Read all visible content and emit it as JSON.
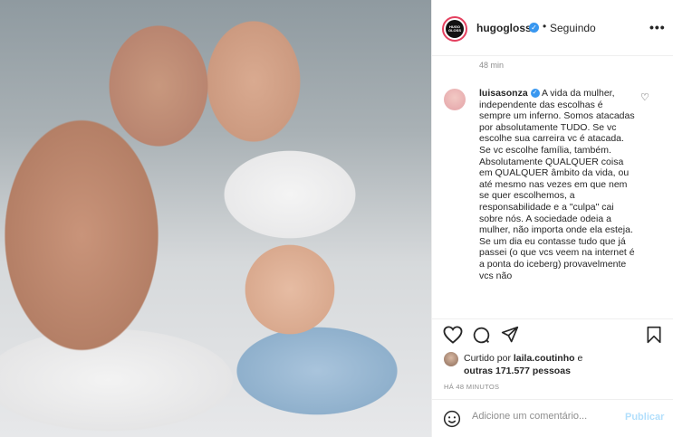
{
  "post": {
    "account": {
      "handle": "hugogloss",
      "avatar_text": "HUGO GLOSS",
      "verified": true,
      "follow_label": "Seguindo"
    },
    "caption_time": "48 min",
    "comment": {
      "user": "luisasonza",
      "text": "A vida da mulher, independente das escolhas é sempre um inferno. Somos atacadas por absolutamente TUDO. Se vc escolhe sua carreira vc é atacada. Se vc escolhe família, também. Absolutamente QUALQUER coisa em QUALQUER âmbito da vida, ou até mesmo nas vezes em que nem se quer escolhemos, a responsabilidade e a \"culpa\" cai sobre nós. A sociedade odeia a mulher, não importa onde ela esteja. Se um dia eu contasse tudo que já passei (o que vcs veem na internet é a ponta do iceberg) provavelmente vcs não"
    },
    "likes": {
      "prefix": "Curtido por",
      "user": "laila.coutinho",
      "suffix_1": "e",
      "suffix_2": "outras 171.577 pessoas"
    },
    "timestamp": "HÁ 48 MINUTOS",
    "comment_input": {
      "placeholder": "Adicione um comentário...",
      "value": ""
    },
    "publish_label": "Publicar",
    "photo_alt": "Couple photo"
  },
  "icons": {
    "verified": "verified-badge-icon",
    "more": "more-options-icon",
    "like": "heart-icon",
    "comment": "comment-icon",
    "share": "share-icon",
    "save": "bookmark-icon",
    "emoji": "emoji-icon"
  },
  "colors": {
    "verified": "#3897f0",
    "publish": "#b2dffc",
    "muted": "#8e8e8e",
    "text": "#262626"
  }
}
